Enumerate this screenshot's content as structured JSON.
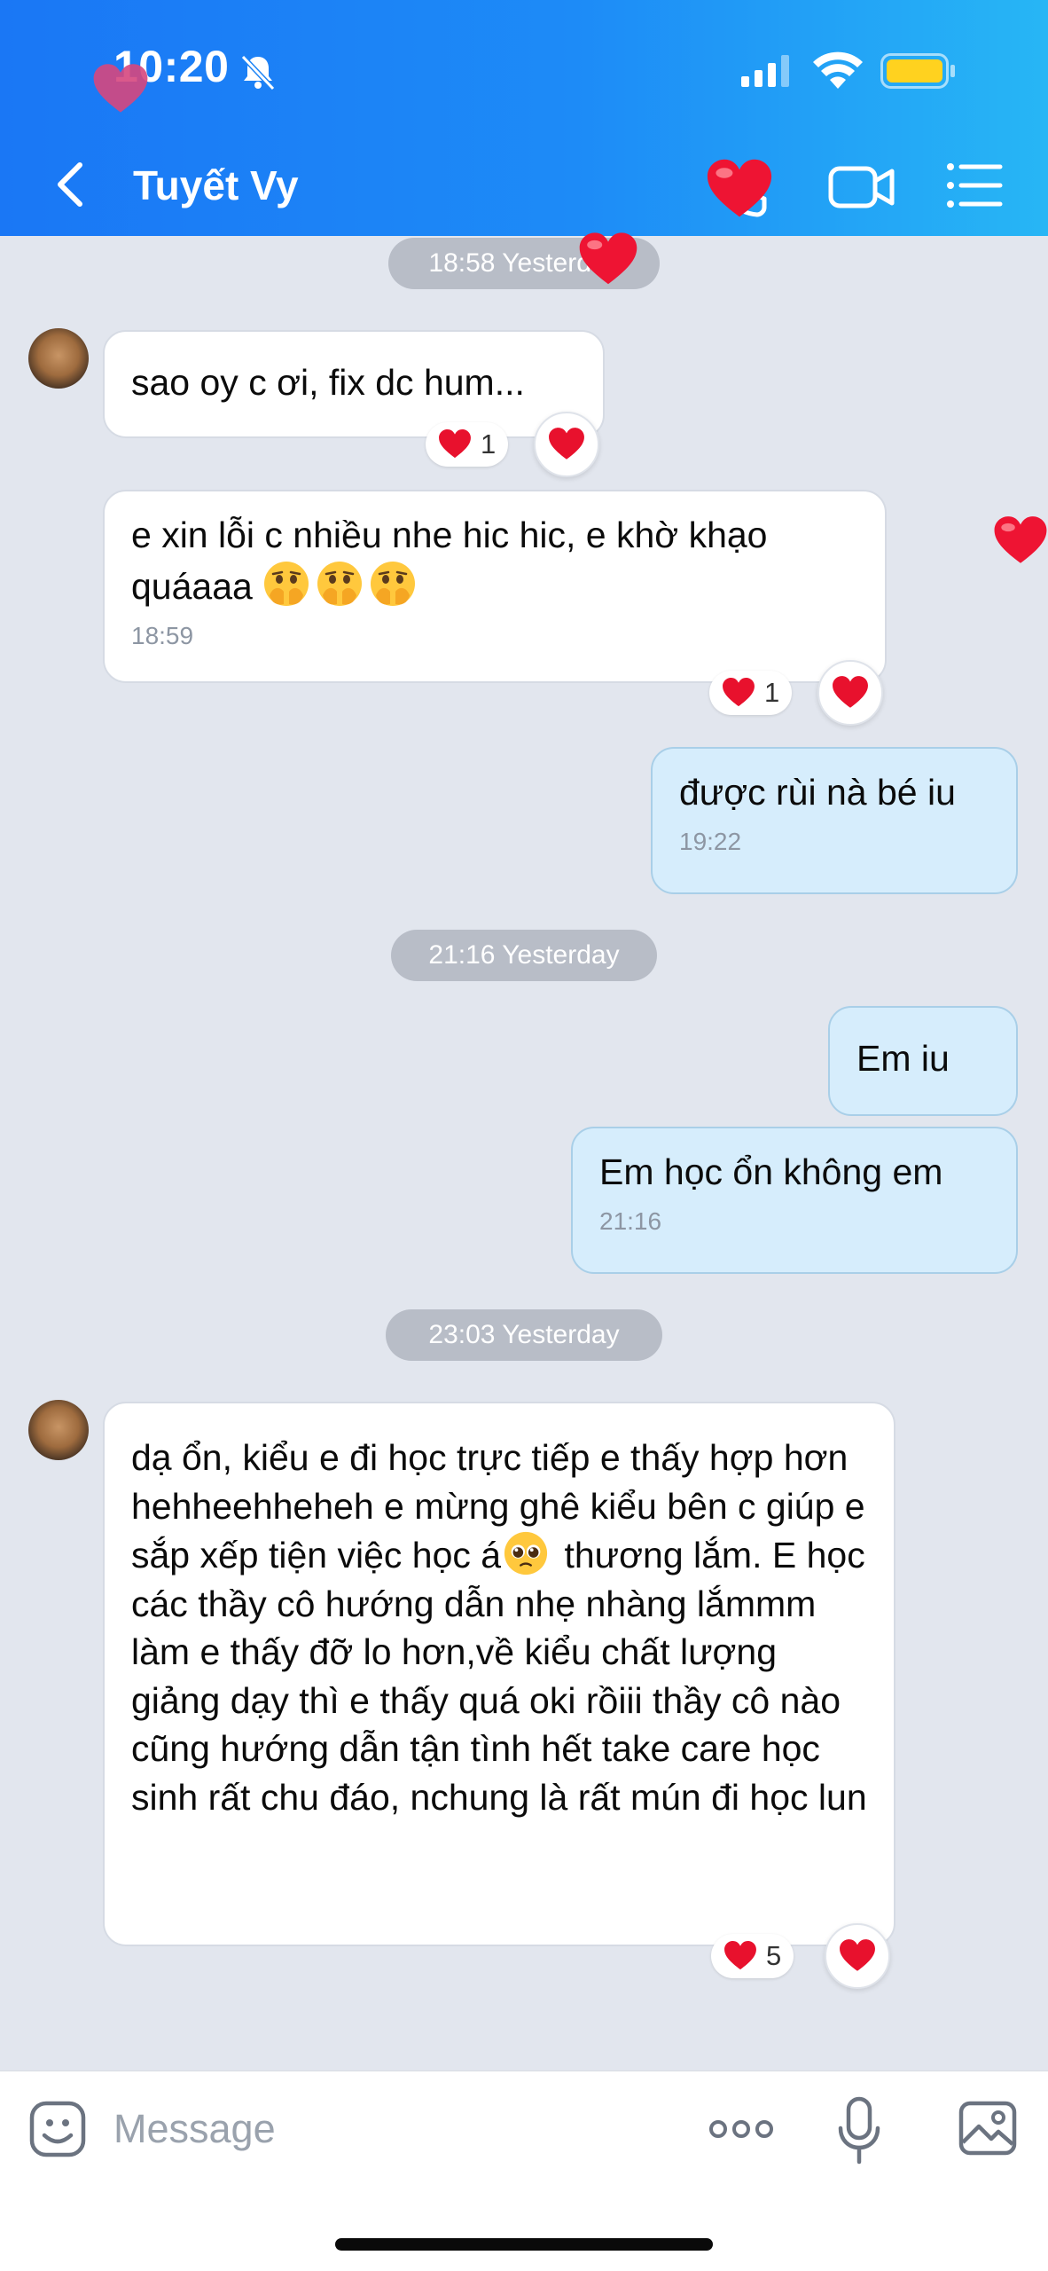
{
  "status_bar": {
    "time": "10:20",
    "icons": [
      "bell-off-icon",
      "signal-icon",
      "wifi-icon",
      "battery-icon"
    ]
  },
  "header": {
    "title": "Tuyết Vy",
    "buttons": [
      "back-icon",
      "call-icon",
      "video-call-icon",
      "menu-icon"
    ]
  },
  "chat": {
    "timestamps": {
      "t1": "18:58 Yesterday",
      "t2": "21:16 Yesterday",
      "t3": "23:03 Yesterday"
    },
    "messages": [
      {
        "side": "in",
        "text": "sao oy c ơi, fix dc hum...",
        "time": "",
        "reaction_count": "1"
      },
      {
        "side": "in",
        "text": "e xin lỗi c nhiều nhe hic hic, e khờ khạo quáaaa",
        "emojis": [
          "pleading-hands-emoji",
          "pleading-hands-emoji",
          "pleading-hands-emoji"
        ],
        "time": "18:59",
        "reaction_count": "1"
      },
      {
        "side": "out",
        "text": "được rùi nà bé iu",
        "time": "19:22"
      },
      {
        "side": "out",
        "text": "Em iu",
        "time": ""
      },
      {
        "side": "out",
        "text": "Em học ổn không em",
        "time": "21:16"
      },
      {
        "side": "in",
        "text_part1": "dạ ổn, kiểu e đi học trực tiếp e thấy hợp hơn hehheehheheh e mừng ghê kiểu bên c giúp e sắp xếp tiện việc học á",
        "emoji": "pleading-face-emoji",
        "text_part2": " thương lắm. E học các thầy cô hướng dẫn nhẹ nhàng lắmmm làm e thấy đỡ lo hơn,về kiểu chất lượng giảng dạy thì e thấy quá oki rồiii thầy cô nào cũng hướng dẫn tận tình hết take care học sinh rất chu đáo, nchung là rất mún đi học lun",
        "time": "",
        "reaction_count": "5"
      }
    ]
  },
  "composer": {
    "placeholder": "Message",
    "buttons": [
      "sticker-icon",
      "more-icon",
      "microphone-icon",
      "image-icon"
    ]
  },
  "colors": {
    "header_start": "#1a77f5",
    "header_end": "#27b6f5",
    "chat_background": "#e2e6ee",
    "outgoing_bubble": "#d6edfc",
    "incoming_bubble": "#ffffff",
    "heart": "#e8112d"
  }
}
